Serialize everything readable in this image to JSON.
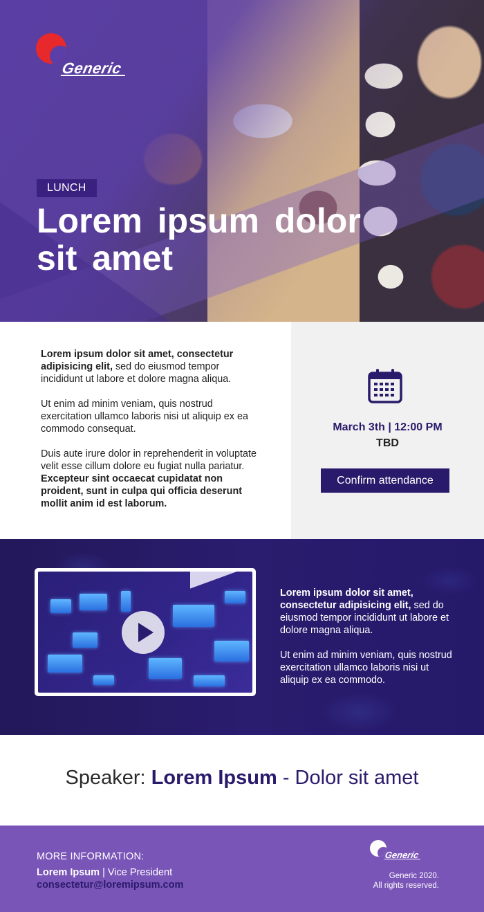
{
  "hero": {
    "logo_text": "Generic",
    "tag": "LUNCH",
    "title": "Lorem  ipsum dolor sit  amet"
  },
  "info": {
    "p1_bold": "Lorem ipsum dolor sit amet, consectetur adipisicing elit,",
    "p1_rest": " sed do eiusmod tempor incididunt ut labore et dolore magna aliqua.",
    "p2": "Ut enim ad minim veniam, quis nostrud exercitation ullamco laboris nisi ut aliquip ex ea commodo consequat.",
    "p3_rest": "Duis aute irure dolor in reprehenderit in voluptate velit esse cillum dolore eu fugiat nulla pariatur. ",
    "p3_bold": "Excepteur sint occaecat cupidatat non proident, sunt in culpa qui officia deserunt mollit anim id est laborum.",
    "date_time": "March 3th | 12:00 PM",
    "place": "TBD",
    "confirm_label": "Confirm attendance",
    "calendar_icon": "calendar-icon"
  },
  "video": {
    "play_icon": "play-icon",
    "p1_bold": "Lorem ipsum dolor sit amet, consectetur adipisicing elit,",
    "p1_rest": " sed do eiusmod tempor incididunt ut labore et dolore magna aliqua.",
    "p2": "Ut enim ad minim veniam, quis nostrud exercitation ullamco laboris nisi ut aliquip ex ea commodo."
  },
  "speaker": {
    "prefix": "Speaker: ",
    "name": "Lorem Ipsum",
    "role": " - Dolor sit amet"
  },
  "footer": {
    "more_label": "MORE INFORMATION:",
    "contact_name": "Lorem Ipsum",
    "contact_title": " | Vice President",
    "email": "consectetur@loremipsum.com",
    "logo_text": "Generic",
    "copyright_line1": "Generic 2020.",
    "copyright_line2": "All rights reserved."
  },
  "colors": {
    "brand_purple": "#5b3ea8",
    "dark_navy": "#2a1a6b",
    "footer_purple": "#7a55b8",
    "logo_red": "#e8292b"
  }
}
